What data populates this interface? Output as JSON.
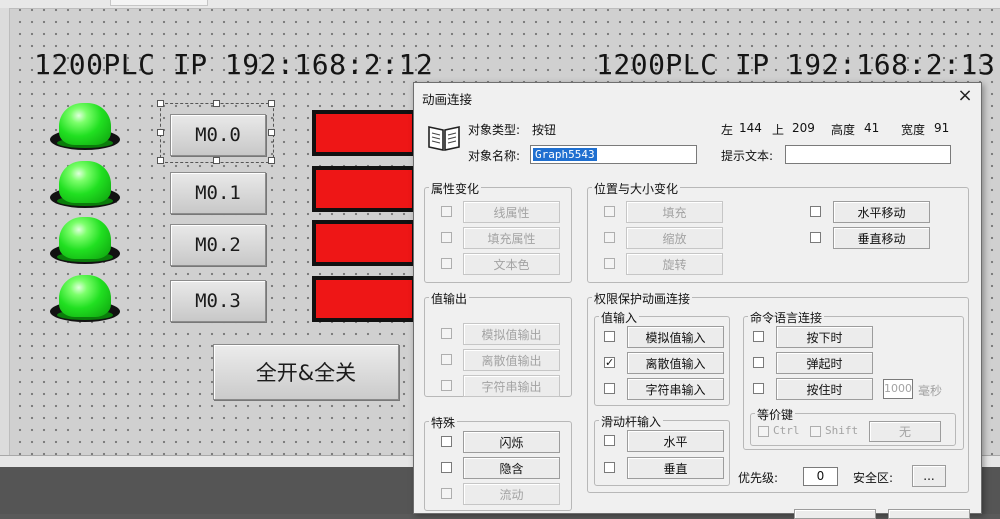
{
  "canvas": {
    "plc_left": "1200PLC IP 192:168:2:12",
    "plc_right": "1200PLC IP 192:168:2:13",
    "buttons": [
      "M0.0",
      "M0.1",
      "M0.2",
      "M0.3"
    ],
    "all_button": "全开&全关"
  },
  "dialog": {
    "title": "动画连接",
    "close": "×",
    "object_type_label": "对象类型:",
    "object_type_value": "按钮",
    "object_name_label": "对象名称:",
    "object_name_value": "Graph5543",
    "left_label": "左",
    "left_value": "144",
    "top_label": "上",
    "top_value": "209",
    "height_label": "高度",
    "height_value": "41",
    "width_label": "宽度",
    "width_value": "91",
    "hint_label": "提示文本:",
    "hint_value": "",
    "attr_group": {
      "title": "属性变化",
      "items": [
        "线属性",
        "填充属性",
        "文本色"
      ]
    },
    "pos_group": {
      "title": "位置与大小变化",
      "items": [
        "填充",
        "缩放",
        "旋转"
      ],
      "move_items": [
        "水平移动",
        "垂直移动"
      ]
    },
    "value_out": {
      "title": "值输出",
      "items": [
        "模拟值输出",
        "离散值输出",
        "字符串输出"
      ]
    },
    "special": {
      "title": "特殊",
      "items": [
        "闪烁",
        "隐含",
        "流动"
      ]
    },
    "perm_group": {
      "title": "权限保护动画连接"
    },
    "value_in": {
      "title": "值输入",
      "items": [
        "模拟值输入",
        "离散值输入",
        "字符串输入"
      ],
      "checked_index": 1
    },
    "slider_in": {
      "title": "滑动杆输入",
      "items": [
        "水平",
        "垂直"
      ]
    },
    "cmd_group": {
      "title": "命令语言连接",
      "items": [
        "按下时",
        "弹起时",
        "按住时"
      ],
      "hold_ms": "1000",
      "ms_unit": "毫秒"
    },
    "hotkey": {
      "title": "等价键",
      "ctrl": "Ctrl",
      "shift": "Shift",
      "none": "无"
    },
    "priority_label": "优先级:",
    "priority_value": "0",
    "security_label": "安全区:",
    "security_button": "..."
  }
}
